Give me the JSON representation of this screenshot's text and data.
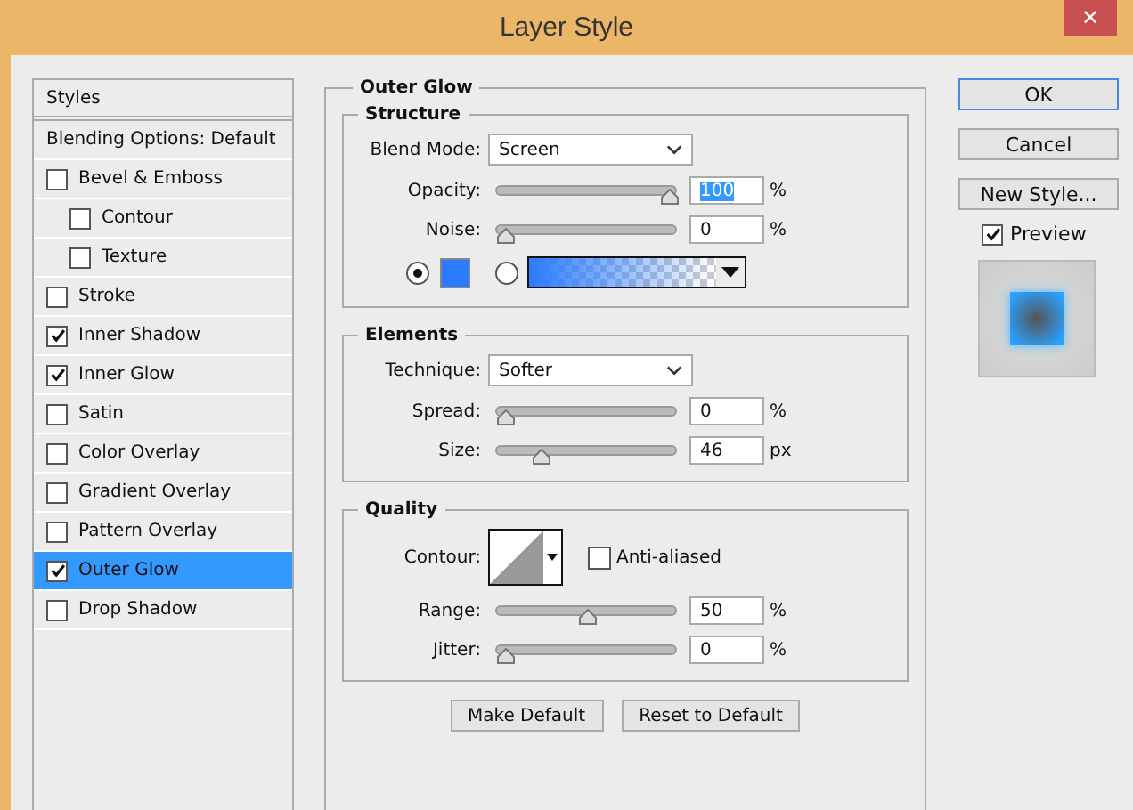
{
  "window": {
    "title": "Layer Style",
    "close": "✕"
  },
  "sidebar": {
    "items": [
      {
        "kind": "header",
        "label": "Styles",
        "selected": false
      },
      {
        "kind": "option",
        "label": "Blending Options: Default",
        "selected": false
      },
      {
        "kind": "checkbox",
        "label": "Bevel & Emboss",
        "checked": false,
        "selected": false,
        "children": [
          {
            "kind": "checkbox",
            "label": "Contour",
            "checked": false,
            "selected": false
          },
          {
            "kind": "checkbox",
            "label": "Texture",
            "checked": false,
            "selected": false
          }
        ]
      },
      {
        "kind": "checkbox",
        "label": "Stroke",
        "checked": false,
        "selected": false
      },
      {
        "kind": "checkbox",
        "label": "Inner Shadow",
        "checked": true,
        "selected": false
      },
      {
        "kind": "checkbox",
        "label": "Inner Glow",
        "checked": true,
        "selected": false
      },
      {
        "kind": "checkbox",
        "label": "Satin",
        "checked": false,
        "selected": false
      },
      {
        "kind": "checkbox",
        "label": "Color Overlay",
        "checked": false,
        "selected": false
      },
      {
        "kind": "checkbox",
        "label": "Gradient Overlay",
        "checked": false,
        "selected": false
      },
      {
        "kind": "checkbox",
        "label": "Pattern Overlay",
        "checked": false,
        "selected": false
      },
      {
        "kind": "checkbox",
        "label": "Outer Glow",
        "checked": true,
        "selected": true
      },
      {
        "kind": "checkbox",
        "label": "Drop Shadow",
        "checked": false,
        "selected": false
      }
    ]
  },
  "panel": {
    "title": "Outer Glow",
    "groups": [
      {
        "title": "Structure",
        "rows": [
          {
            "kind": "dropdown",
            "label": "Blend Mode:",
            "value": "Screen"
          },
          {
            "kind": "slider",
            "label": "Opacity:",
            "level": 1,
            "value": "100",
            "unit": "%",
            "highlighted": true
          },
          {
            "kind": "slider",
            "label": "Noise:",
            "level": 0,
            "value": "0",
            "unit": "%",
            "highlighted": false
          },
          {
            "kind": "color",
            "solid_selected": true,
            "color": "#2a7bff"
          }
        ]
      },
      {
        "title": "Elements",
        "rows": [
          {
            "kind": "dropdown",
            "label": "Technique:",
            "value": "Softer"
          },
          {
            "kind": "slider",
            "label": "Spread:",
            "level": 0,
            "value": "0",
            "unit": "%",
            "highlighted": false
          },
          {
            "kind": "slider",
            "label": "Size:",
            "level": 0.22,
            "value": "46",
            "unit": "px",
            "highlighted": false
          }
        ]
      },
      {
        "title": "Quality",
        "rows": [
          {
            "kind": "contour",
            "label": "Contour:",
            "anti_aliased_label": "Anti-aliased",
            "anti_aliased": false
          },
          {
            "kind": "slider",
            "label": "Range:",
            "level": 0.5,
            "value": "50",
            "unit": "%",
            "highlighted": false
          },
          {
            "kind": "slider",
            "label": "Jitter:",
            "level": 0,
            "value": "0",
            "unit": "%",
            "highlighted": false
          }
        ]
      }
    ],
    "buttons": [
      "Make Default",
      "Reset to Default"
    ]
  },
  "actions": {
    "buttons": [
      {
        "label": "OK",
        "default": true
      },
      {
        "label": "Cancel",
        "default": false
      },
      {
        "label": "New Style...",
        "default": false
      }
    ],
    "preview": {
      "label": "Preview",
      "checked": true
    }
  }
}
